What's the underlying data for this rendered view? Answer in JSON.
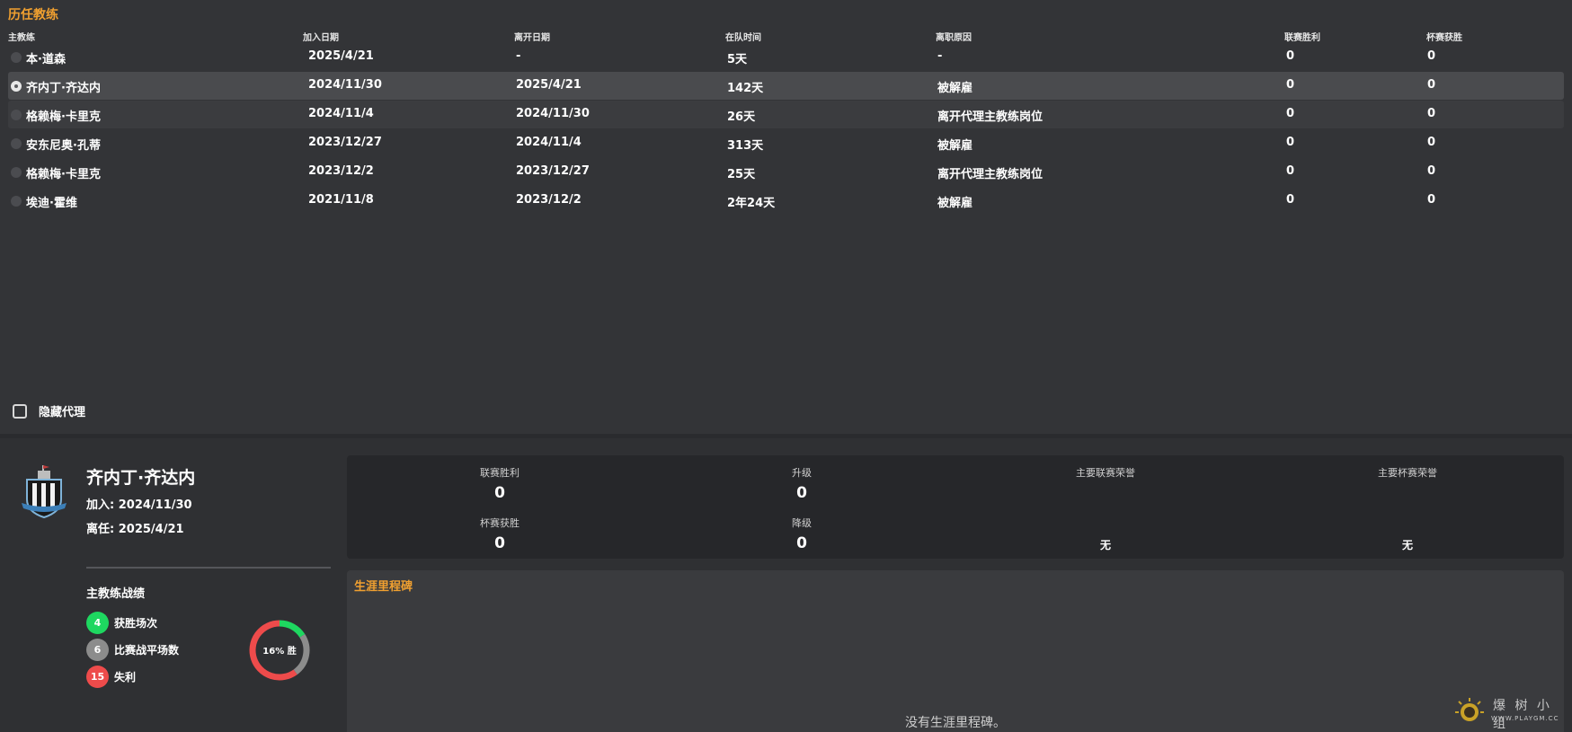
{
  "history": {
    "title": "历任教练",
    "columns": {
      "coach": "主教练",
      "join_date": "加入日期",
      "leave_date": "离开日期",
      "tenure": "在队时间",
      "reason": "离职原因",
      "league_wins": "联赛胜利",
      "cup_wins": "杯赛获胜"
    },
    "rows": [
      {
        "coach": "本·道森",
        "join_date": "2025/4/21",
        "leave_date": "-",
        "tenure": "5天",
        "reason": "-",
        "league_wins": "0",
        "cup_wins": "0"
      },
      {
        "coach": "齐内丁·齐达内",
        "join_date": "2024/11/30",
        "leave_date": "2025/4/21",
        "tenure": "142天",
        "reason": "被解雇",
        "league_wins": "0",
        "cup_wins": "0"
      },
      {
        "coach": "格赖梅·卡里克",
        "join_date": "2024/11/4",
        "leave_date": "2024/11/30",
        "tenure": "26天",
        "reason": "离开代理主教练岗位",
        "league_wins": "0",
        "cup_wins": "0"
      },
      {
        "coach": "安东尼奥·孔蒂",
        "join_date": "2023/12/27",
        "leave_date": "2024/11/4",
        "tenure": "313天",
        "reason": "被解雇",
        "league_wins": "0",
        "cup_wins": "0"
      },
      {
        "coach": "格赖梅·卡里克",
        "join_date": "2023/12/2",
        "leave_date": "2023/12/27",
        "tenure": "25天",
        "reason": "离开代理主教练岗位",
        "league_wins": "0",
        "cup_wins": "0"
      },
      {
        "coach": "埃迪·霍维",
        "join_date": "2021/11/8",
        "leave_date": "2023/12/2",
        "tenure": "2年24天",
        "reason": "被解雇",
        "league_wins": "0",
        "cup_wins": "0"
      }
    ],
    "selected_index": 1,
    "hide_agent_label": "隐藏代理",
    "hide_agent_checked": false
  },
  "detail": {
    "name": "齐内丁·齐达内",
    "join_line": "加入: 2024/11/30",
    "leave_line": "离任: 2025/4/21",
    "record_title": "主教练战绩",
    "stats": [
      {
        "value": "4",
        "label": "获胜场次",
        "color": "#1ed760"
      },
      {
        "value": "6",
        "label": "比赛战平场数",
        "color": "#8c8c8c"
      },
      {
        "value": "15",
        "label": "失利",
        "color": "#ee4b4b"
      }
    ],
    "win_percent_label": "16% 胜",
    "win_fraction": 0.16,
    "draw_fraction": 0.24,
    "loss_fraction": 0.6,
    "summary": {
      "league_wins_label": "联赛胜利",
      "league_wins_value": "0",
      "promotion_label": "升级",
      "promotion_value": "0",
      "major_league_honours_label": "主要联赛荣誉",
      "major_cup_honours_label": "主要杯赛荣誉",
      "cup_wins_label": "杯赛获胜",
      "cup_wins_value": "0",
      "relegation_label": "降级",
      "relegation_value": "0",
      "major_league_honours_value": "无",
      "major_cup_honours_value": "无"
    },
    "milestones_title": "生涯里程碑",
    "milestones_empty": "没有生涯里程碑。"
  },
  "watermark": {
    "line1": "爆 树 小 组",
    "line2": "WWW.PLAYGM.CC"
  }
}
